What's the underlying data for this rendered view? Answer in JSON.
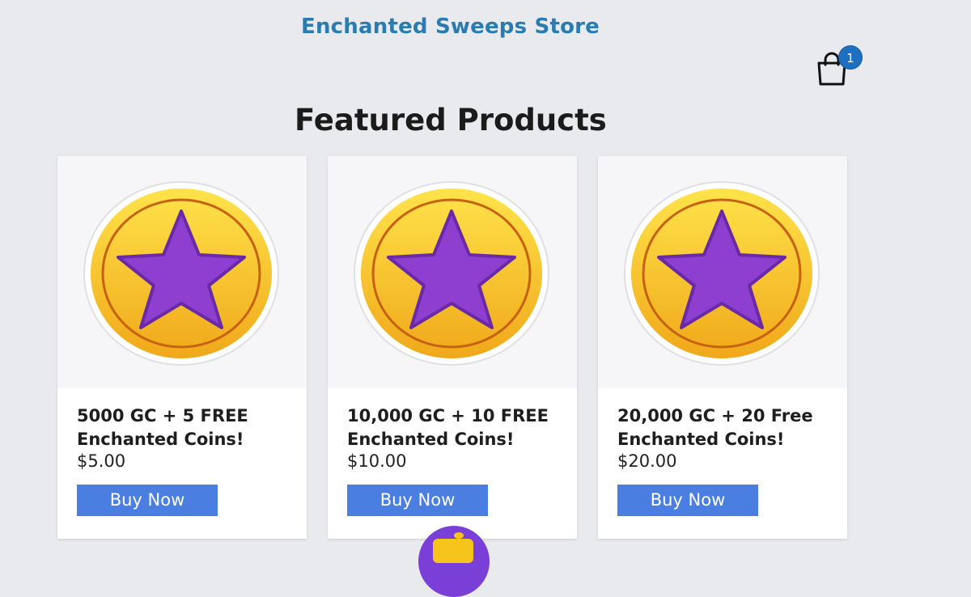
{
  "header": {
    "store_title": "Enchanted Sweeps Store",
    "cart_count": "1",
    "cart_icon": "shopping-bag-icon"
  },
  "main": {
    "section_title": "Featured Products",
    "products": [
      {
        "name": "5000 GC + 5 FREE Enchanted Coins!",
        "price": "$5.00",
        "button_label": "Buy Now",
        "image_icon": "gold-coin-purple-star-icon"
      },
      {
        "name": "10,000 GC + 10 FREE Enchanted Coins!",
        "price": "$10.00",
        "button_label": "Buy Now",
        "image_icon": "gold-coin-purple-star-icon"
      },
      {
        "name": "20,000 GC + 20 Free Enchanted Coins!",
        "price": "$20.00",
        "button_label": "Buy Now",
        "image_icon": "gold-coin-purple-star-icon"
      }
    ]
  },
  "colors": {
    "page_background": "#e9eaee",
    "title_blue": "#2a7bb0",
    "button_blue": "#4a7ee0",
    "badge_blue": "#1f6fc0",
    "coin_gold": "#f5c51c",
    "star_purple": "#8e3fd0"
  },
  "floating_widget": {
    "icon": "purple-coin-widget-icon"
  }
}
